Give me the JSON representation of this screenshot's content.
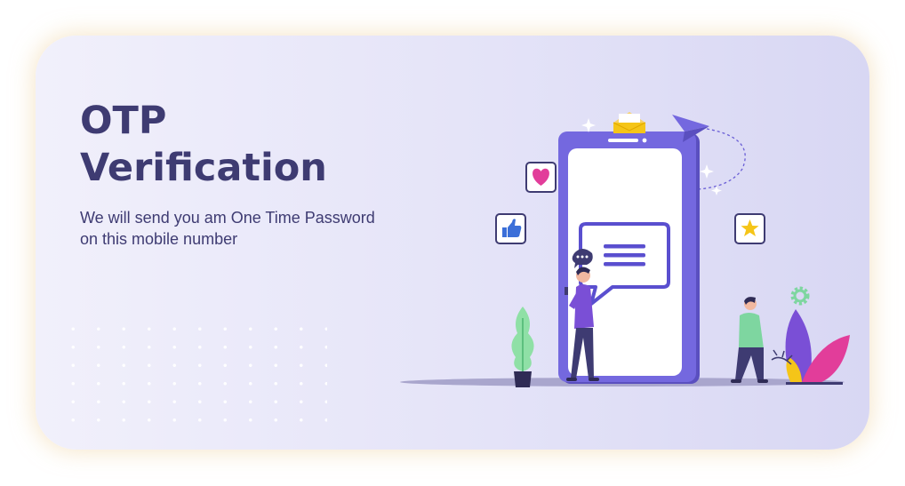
{
  "hero": {
    "title_line1": "OTP",
    "title_line2": "Verification",
    "subtitle_line1": "We will send you am One Time Password",
    "subtitle_line2": "on this mobile number"
  },
  "colors": {
    "card_background": "#e6e5f8",
    "title_text": "#3e3b72",
    "phone_frame": "#6a5fd6",
    "message_bubble": "#5a4fcf",
    "accent_pink": "#e23d9a",
    "accent_yellow": "#f5c518"
  },
  "illustration": {
    "icons": [
      "heart-icon",
      "thumbs-up-icon",
      "star-icon",
      "gear-icon",
      "envelope-icon",
      "paper-plane-icon",
      "message-icon",
      "typing-bubble-icon",
      "sparkle-icon"
    ]
  }
}
